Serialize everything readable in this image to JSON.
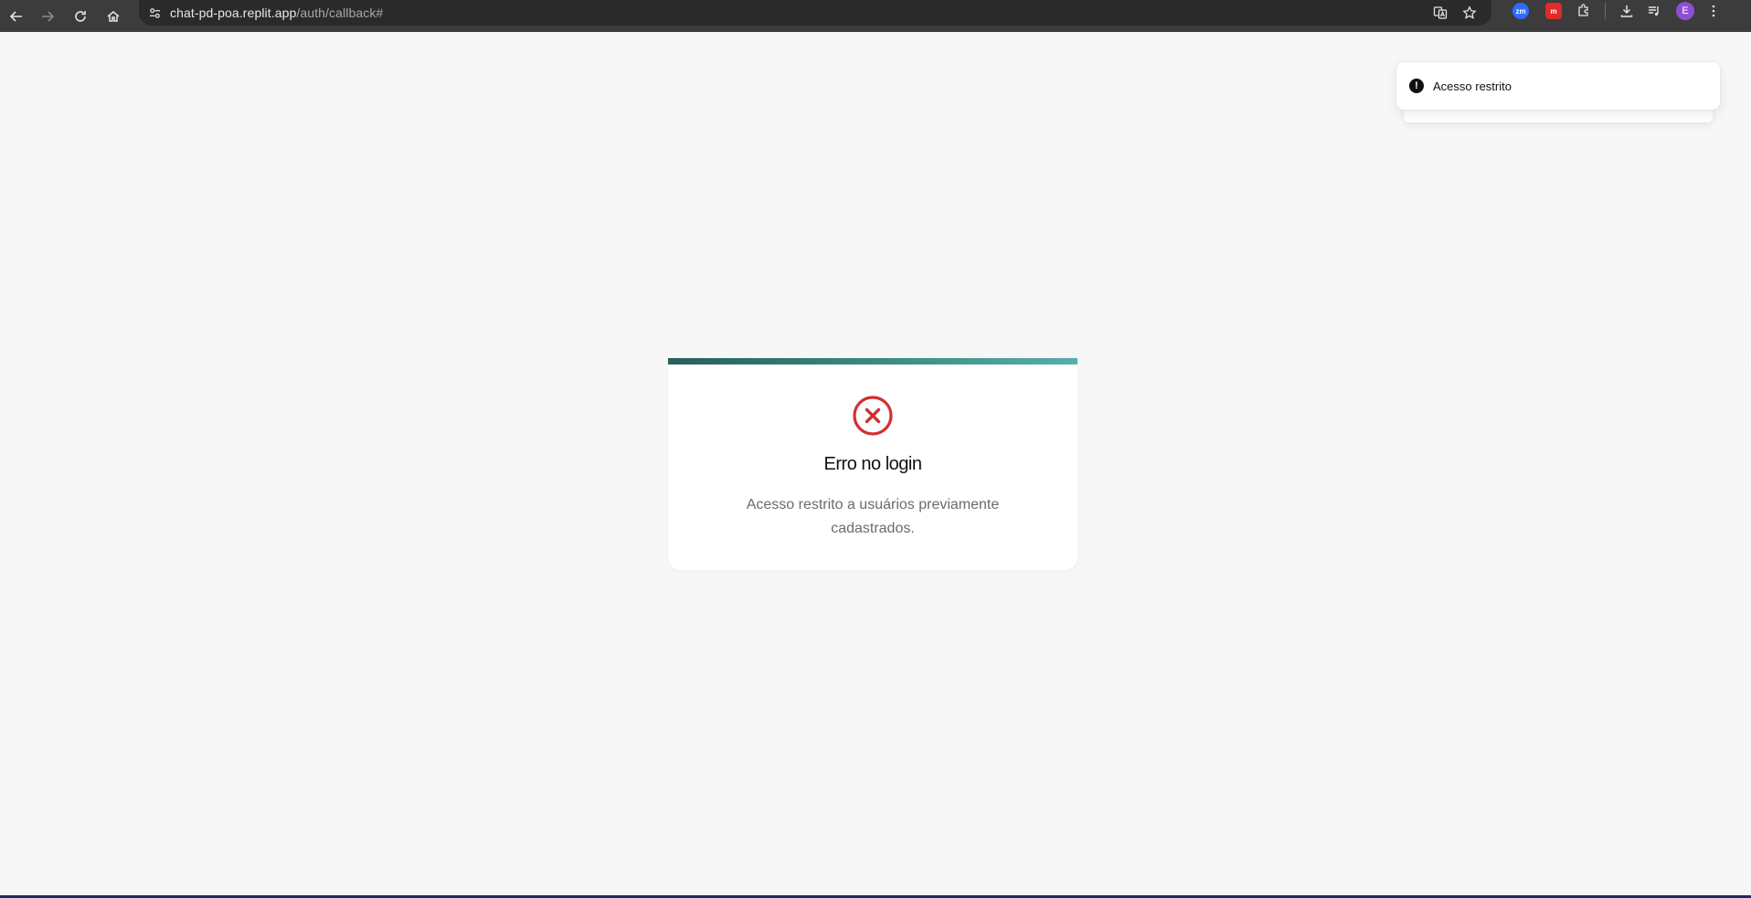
{
  "browser": {
    "url_host": "chat-pd-poa.replit.app",
    "url_path": "/auth/callback#",
    "profile_initial": "E",
    "extensions": [
      {
        "name": "zm",
        "label": "zm",
        "color": "#2d6cff"
      },
      {
        "name": "mr",
        "label": "m",
        "color": "#e02b2b"
      }
    ]
  },
  "toast": {
    "message": "Acesso restrito"
  },
  "card": {
    "title": "Erro no login",
    "message": "Acesso restrito a usuários previamente cadastrados.",
    "accent_colors": [
      "#285f5a",
      "#56aeaa"
    ],
    "error_color": "#d32f2f"
  }
}
